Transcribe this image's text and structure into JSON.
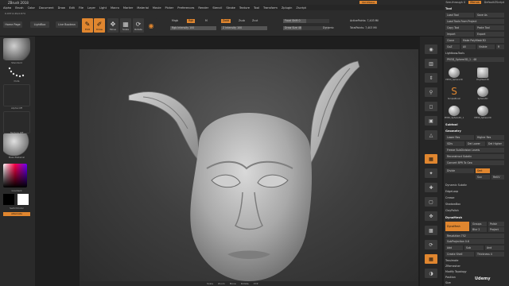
{
  "app": {
    "window_title": "ZBrush 2018",
    "quicksave_label": "QuickSave",
    "see_through_label": "See-through 0",
    "menus_label": "Menus",
    "default_script_label": "DefaultZScript"
  },
  "menubar": {
    "items": [
      "Alpha",
      "Brush",
      "Color",
      "Document",
      "Draw",
      "Edit",
      "File",
      "Layer",
      "Light",
      "Macro",
      "Marker",
      "Material",
      "Movie",
      "Picker",
      "Preferences",
      "Render",
      "Stencil",
      "Stroke",
      "Texture",
      "Tool",
      "Transform",
      "Zplugin",
      "Zscript"
    ]
  },
  "status_text": "0.037,0.49,0.674",
  "toolbar": {
    "home_page": "Home Page",
    "lightbox": "LightBox",
    "live_boolean": "Live Boolean",
    "edit": "Edit",
    "draw": "Draw",
    "move": "Move",
    "scale": "Scale",
    "rotate": "Rotate",
    "mrgb": "Mrgb",
    "rgb": "Rgb",
    "m": "M",
    "zadd": "Zadd",
    "zsub": "Zsub",
    "zcut": "Zcut",
    "rgb_intensity": "Rgb Intensity 100",
    "z_intensity": "Z Intensity 100",
    "focal_shift": "Focal Shift 0",
    "draw_size": "Draw Size 48",
    "dynamic": "Dynamic",
    "active_points": "ActivePoints: 7,403 Mil",
    "total_points": "TotalPoints: 7,403 Mil"
  },
  "leftpanel": {
    "brush1": "Standard",
    "stroke": "Dots",
    "alpha": "Alpha Off",
    "texture": "Texture Off",
    "material": "BasicMaterial",
    "gradient": "Gradient",
    "switch_color": "SwitchColor",
    "alternate": "Alternate"
  },
  "viewport_bottom": {
    "items": [
      "Scale",
      "Zoom",
      "Move",
      "Rotate",
      "XYZ"
    ]
  },
  "rightpanel": {
    "tool_title": "Tool",
    "load_tool": "Load Tool",
    "save_as": "Save As",
    "load_tools_from_project": "Load Tools From Project",
    "copy_tool": "Copy Tool",
    "paste_tool": "Paste Tool",
    "import": "Import",
    "export": "Export",
    "clone": "Clone",
    "make_polymesh": "Make PolyMesh3D",
    "goz": "GoZ",
    "all": "All",
    "visible": "Visible",
    "r": "R",
    "lightbox_tools": "Lightbox▸Tools",
    "current_tool": "PM3D_Sphere3D_1 . 48",
    "tools": [
      {
        "name": "PM3D_Sphere3D"
      },
      {
        "name": "PolyMesh3D"
      },
      {
        "name": "SimpleBrush"
      },
      {
        "name": "Sphere3D"
      },
      {
        "name": "PM3D_Sphere3D_1"
      },
      {
        "name": "PM3D_Sphere3D"
      }
    ],
    "subtool": "Subtool",
    "geometry": "Geometry",
    "lower_res": "Lower Res",
    "higher_res": "Higher Res",
    "sdiv": "SDiv",
    "del_lower": "Del Lower",
    "del_higher": "Del Higher",
    "freeze_subdiv": "Freeze SubDivision Levels",
    "reconstruct_subdiv": "Reconstruct Subdiv",
    "convert_bpr": "Convert BPR To Geo",
    "divide": "Divide",
    "smt": "Smt",
    "suv": "Suv",
    "reuv": "ReUV",
    "dynamic_subdiv": "Dynamic Subdiv",
    "edgeloop": "EdgeLoop",
    "crease": "Crease",
    "shadowbox": "ShadowBox",
    "claypolish": "ClayPolish",
    "dynamesh_head": "DynaMesh",
    "dynamesh_btn": "DynaMesh",
    "groups": "Groups",
    "polish": "Polish",
    "blur": "Blur 2",
    "project": "Project",
    "resolution": "Resolution 752",
    "subprojection": "SubProjection 0.6",
    "add": "Add",
    "sub": "Sub",
    "and": "And",
    "create_shell": "Create Shell",
    "thickness": "Thickness 4",
    "tessimate": "Tessimate",
    "zremesher": "ZRemesher",
    "modify_topology": "Modify Topology",
    "position": "Position",
    "size": "Size"
  },
  "watermark": "Udemy",
  "colors": {
    "accent": "#e0862f",
    "panel": "#2b2b2b",
    "background": "#1e1e1e"
  }
}
